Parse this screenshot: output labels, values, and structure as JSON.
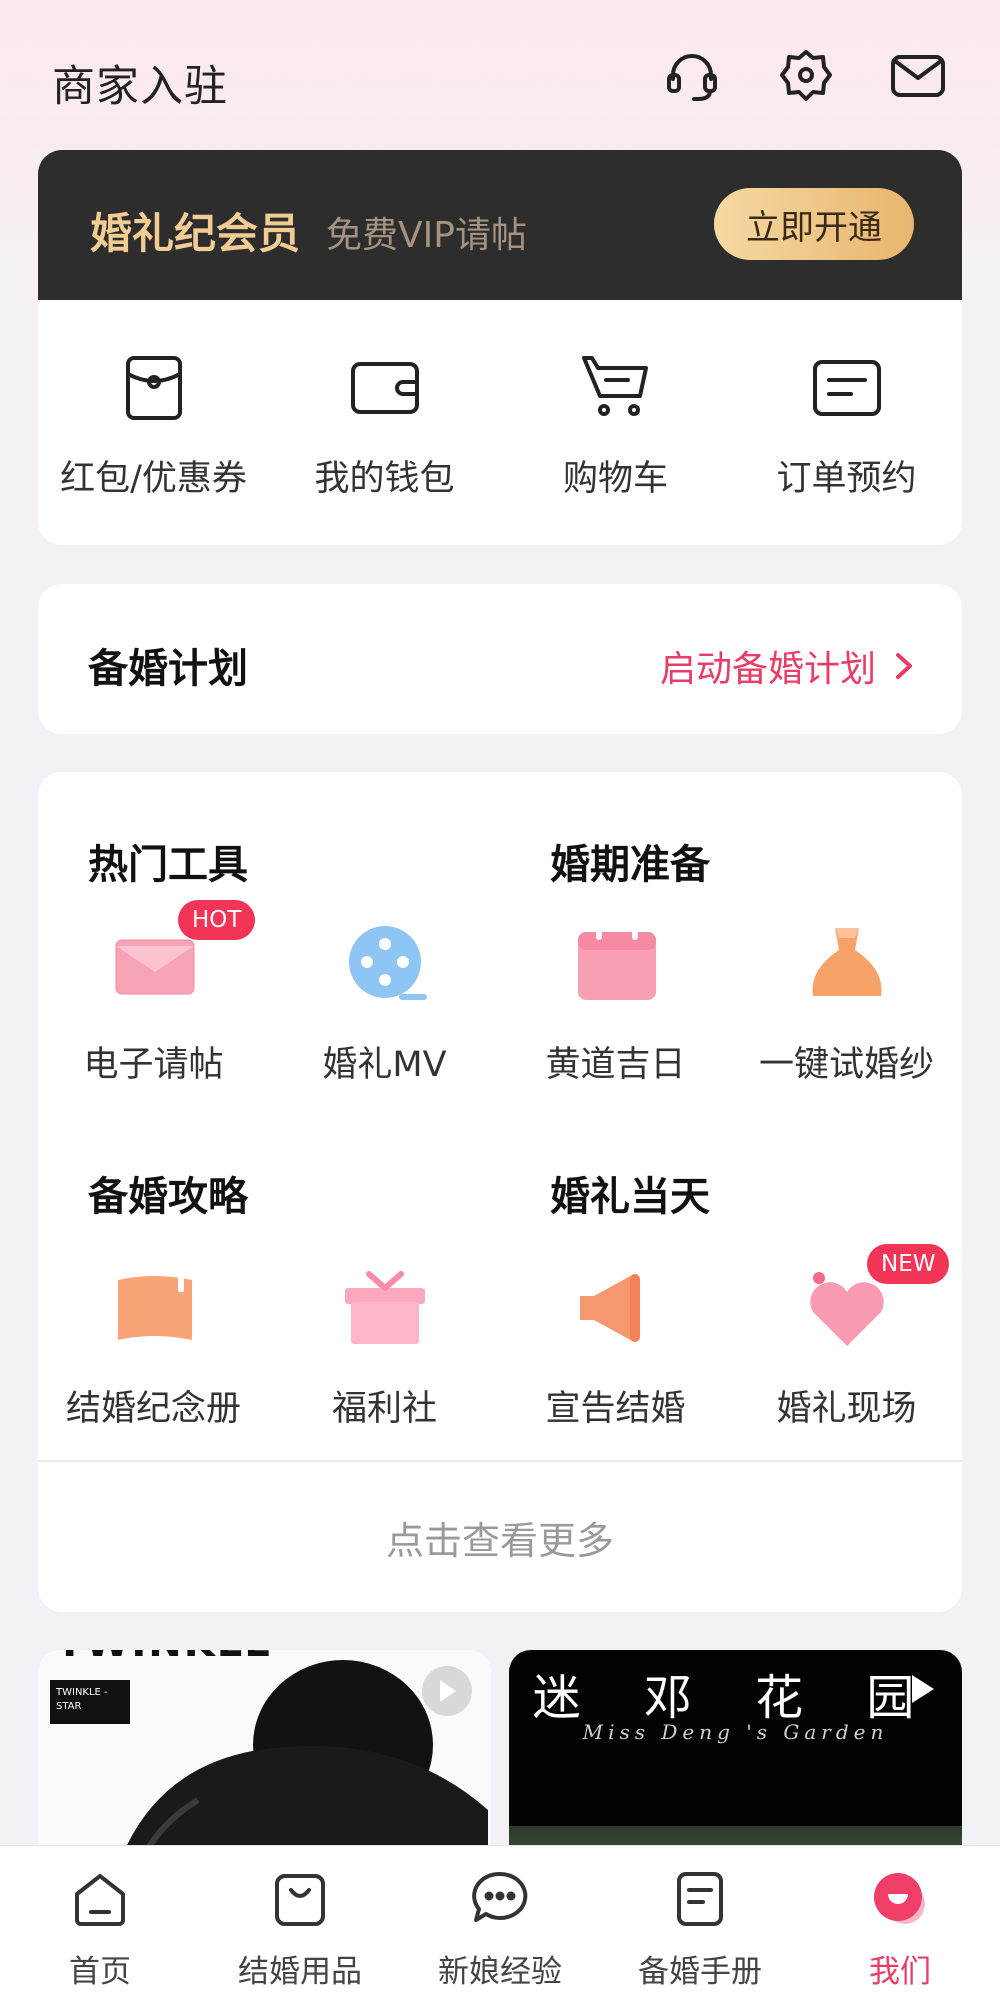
{
  "header": {
    "title": "商家入驻",
    "icons": [
      "headset-icon",
      "settings-icon",
      "mail-icon"
    ]
  },
  "vip": {
    "title": "婚礼纪会员",
    "subtitle": "免费VIP请帖",
    "button": "立即开通"
  },
  "quick_actions": [
    {
      "label": "红包/优惠券",
      "icon": "coupon-icon"
    },
    {
      "label": "我的钱包",
      "icon": "wallet-icon"
    },
    {
      "label": "购物车",
      "icon": "cart-icon"
    },
    {
      "label": "订单预约",
      "icon": "order-icon"
    }
  ],
  "plan": {
    "title": "备婚计划",
    "link": "启动备婚计划"
  },
  "sections": [
    {
      "title": "热门工具",
      "items": [
        {
          "label": "电子请帖",
          "icon": "invitation-icon",
          "badge": "HOT"
        },
        {
          "label": "婚礼MV",
          "icon": "film-reel-icon"
        }
      ]
    },
    {
      "title": "婚期准备",
      "items": [
        {
          "label": "黄道吉日",
          "icon": "calendar-icon"
        },
        {
          "label": "一键试婚纱",
          "icon": "wedding-dress-icon"
        }
      ]
    },
    {
      "title": "备婚攻略",
      "items": [
        {
          "label": "结婚纪念册",
          "icon": "album-icon"
        },
        {
          "label": "福利社",
          "icon": "gift-box-icon"
        }
      ]
    },
    {
      "title": "婚礼当天",
      "items": [
        {
          "label": "宣告结婚",
          "icon": "megaphone-icon"
        },
        {
          "label": "婚礼现场",
          "icon": "heart-pin-icon",
          "badge": "NEW"
        }
      ]
    }
  ],
  "more": "点击查看更多",
  "videos": [
    {
      "brand_top": "TWINKLE",
      "brand_tag": "TWINKLE -STAR"
    },
    {
      "title": "迷 邓 花 园",
      "subtitle": "Miss Deng 's Garden"
    }
  ],
  "nav": [
    {
      "label": "首页",
      "icon": "home-icon",
      "active": false
    },
    {
      "label": "结婚用品",
      "icon": "bag-icon",
      "active": false
    },
    {
      "label": "新娘经验",
      "icon": "chat-bubble-icon",
      "active": false
    },
    {
      "label": "备婚手册",
      "icon": "handbook-icon",
      "active": false
    },
    {
      "label": "我们",
      "icon": "us-icon",
      "active": true
    }
  ],
  "colors": {
    "accent": "#e83d66",
    "vip_gold": "#f2cd93",
    "vip_bg": "#2e2d2d"
  }
}
